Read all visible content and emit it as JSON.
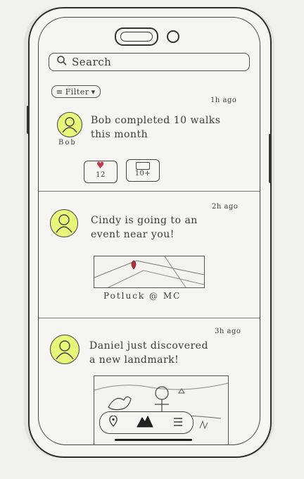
{
  "search": {
    "placeholder": "Search"
  },
  "filter": {
    "label": "Filter"
  },
  "posts": [
    {
      "time": "1h ago",
      "text_line1": "Bob completed 10 walks",
      "text_line2": "this month",
      "avatar_label": "Bob",
      "likes": "12",
      "comments": "10+"
    },
    {
      "time": "2h ago",
      "text_line1": "Cindy is going to an",
      "text_line2": "event near you!",
      "caption": "Potluck @ MC"
    },
    {
      "time": "3h ago",
      "text_line1": "Daniel just discovered",
      "text_line2": "a new landmark!"
    }
  ],
  "colors": {
    "avatar_highlight": "#e6f77a",
    "heart": "#c0394b",
    "map_pin": "#b5303a"
  }
}
